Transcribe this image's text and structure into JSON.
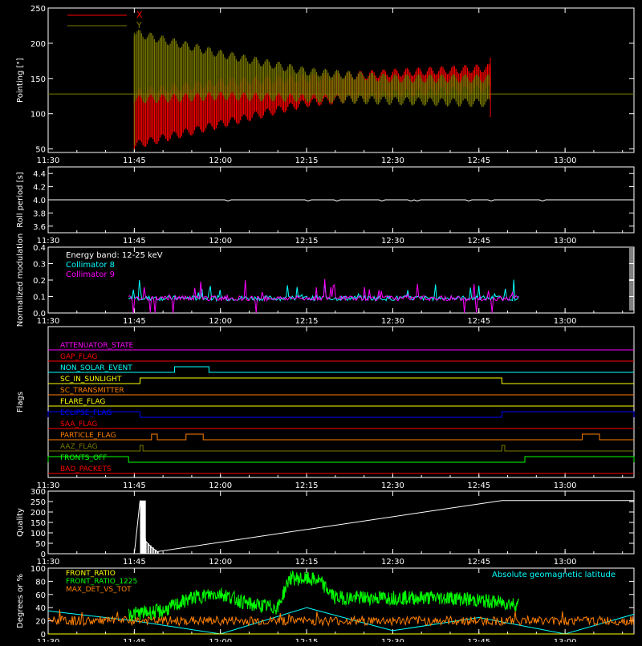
{
  "time_ticks": [
    "11:30",
    "11:45",
    "12:00",
    "12:15",
    "12:30",
    "12:45",
    "13:00"
  ],
  "colors": {
    "axis": "#ffffff",
    "bg": "#000000",
    "red": "#ff0000",
    "olive": "#7a7a00",
    "cyan": "#00ffff",
    "magenta": "#ff00ff",
    "green": "#00ff00",
    "orange": "#ff8000",
    "blue": "#0000ff",
    "yellow": "#ffff00"
  },
  "chart_data": [
    {
      "id": "pointing",
      "type": "area",
      "ylabel": "Pointing [\"]",
      "ylim": [
        45,
        250
      ],
      "yticks": [
        "50",
        "100",
        "150",
        "200",
        "250"
      ],
      "series": [
        {
          "name": "X",
          "color": "#ff0000",
          "x": [
            "11:45",
            "12:00",
            "12:15",
            "12:30",
            "12:47"
          ],
          "low": [
            55,
            85,
            115,
            128,
            135
          ],
          "high": [
            130,
            145,
            150,
            158,
            165
          ]
        },
        {
          "name": "Y",
          "color": "#7a7a00",
          "x": [
            "11:45",
            "12:00",
            "12:15",
            "12:30",
            "12:47"
          ],
          "low": [
            120,
            125,
            122,
            118,
            115
          ],
          "high": [
            215,
            185,
            160,
            150,
            150
          ]
        }
      ],
      "baseline": 128
    },
    {
      "id": "roll",
      "type": "line",
      "ylabel": "Roll period [s]",
      "ylim": [
        3.5,
        4.5
      ],
      "yticks": [
        "3.6",
        "3.8",
        "4.0",
        "4.2",
        "4.4"
      ],
      "series": [
        {
          "name": "",
          "color": "#ffffff",
          "value": 4.0
        }
      ]
    },
    {
      "id": "modulation",
      "type": "line",
      "ylabel": "Normalized modulation",
      "ylim": [
        0,
        0.4
      ],
      "yticks": [
        "0.0",
        "0.1",
        "0.2",
        "0.3",
        "0.4"
      ],
      "legend": [
        "Energy band: 12-25 keV",
        "Collimator 8",
        "Collimator 9"
      ],
      "series": [
        {
          "name": "Collimator 8",
          "color": "#00ffff",
          "x_range": [
            "11:44",
            "12:52"
          ],
          "base": 0.09
        },
        {
          "name": "Collimator 9",
          "color": "#ff00ff",
          "x_range": [
            "11:44",
            "12:52"
          ],
          "base": 0.09
        }
      ]
    },
    {
      "id": "flags",
      "type": "line",
      "ylabel": "Flags",
      "flags": [
        {
          "name": "ATTENUATOR_STATE",
          "color": "#ff00ff",
          "segments": []
        },
        {
          "name": "GAP_FLAG",
          "color": "#ff0000",
          "segments": []
        },
        {
          "name": "NON_SOLAR_EVENT",
          "color": "#00ffff",
          "segments": [
            [
              "11:52",
              "11:58"
            ]
          ]
        },
        {
          "name": "SC_IN_SUNLIGHT",
          "color": "#ffff00",
          "segments": [
            [
              "11:46",
              "12:49"
            ]
          ]
        },
        {
          "name": "SC_TRANSMITTER",
          "color": "#ff8000",
          "segments": []
        },
        {
          "name": "FLARE_FLAG",
          "color": "#ffff00",
          "segments": []
        },
        {
          "name": "ECLIPSE_FLAG",
          "color": "#0000ff",
          "segments": [
            [
              "11:30",
              "11:46"
            ],
            [
              "12:49",
              "13:12"
            ]
          ]
        },
        {
          "name": "SAA_FLAG",
          "color": "#ff0000",
          "segments": []
        },
        {
          "name": "PARTICLE_FLAG",
          "color": "#ff8000",
          "segments": [
            [
              "11:48",
              "11:49"
            ],
            [
              "11:54",
              "11:57"
            ],
            [
              "13:03",
              "13:06"
            ]
          ]
        },
        {
          "name": "AAZ_FLAG",
          "color": "#7a7a00",
          "segments": [
            [
              "11:46",
              "11:46.5"
            ],
            [
              "12:49",
              "12:49.5"
            ]
          ]
        },
        {
          "name": "FRONTS_OFF",
          "color": "#00ff00",
          "segments": [
            [
              "11:30",
              "11:44"
            ],
            [
              "12:53",
              "13:12"
            ]
          ]
        },
        {
          "name": "BAD_PACKETS",
          "color": "#ff0000",
          "segments": []
        }
      ]
    },
    {
      "id": "quality",
      "type": "bar",
      "ylabel": "Quality",
      "ylim": [
        0,
        300
      ],
      "yticks": [
        "0",
        "50",
        "100",
        "150",
        "200",
        "250",
        "300"
      ],
      "series": [
        {
          "name": "",
          "color": "#ffffff",
          "x": [
            "11:30",
            "11:45",
            "11:46",
            "11:47",
            "11:48",
            "11:49",
            "12:49",
            "13:12"
          ],
          "values": [
            0,
            0,
            255,
            60,
            30,
            10,
            255,
            255
          ]
        }
      ]
    },
    {
      "id": "ratios",
      "type": "line",
      "ylabel": "Degrees or %",
      "ylim": [
        0,
        100
      ],
      "yticks": [
        "0",
        "20",
        "40",
        "60",
        "80",
        "100"
      ],
      "annotation": "Absolute geomagnetic latitude",
      "series": [
        {
          "name": "FRONT_RATIO",
          "color": "#ffff00"
        },
        {
          "name": "FRONT_RATIO_1225",
          "color": "#00ff00",
          "x": [
            "11:44",
            "11:50",
            "11:55",
            "12:00",
            "12:05",
            "12:10",
            "12:12",
            "12:17",
            "12:20",
            "12:30",
            "12:40",
            "12:52"
          ],
          "values": [
            30,
            35,
            55,
            62,
            45,
            40,
            85,
            82,
            55,
            55,
            55,
            45
          ]
        },
        {
          "name": "MAX_DET_VS_TOT",
          "color": "#ff8000",
          "value": 20
        },
        {
          "name": "Absolute geomagnetic latitude",
          "color": "#00ffff",
          "x": [
            "11:30",
            "11:45",
            "12:00",
            "12:15",
            "12:30",
            "12:45",
            "13:00",
            "13:12"
          ],
          "values": [
            35,
            20,
            0,
            40,
            5,
            25,
            0,
            30
          ]
        }
      ]
    }
  ]
}
